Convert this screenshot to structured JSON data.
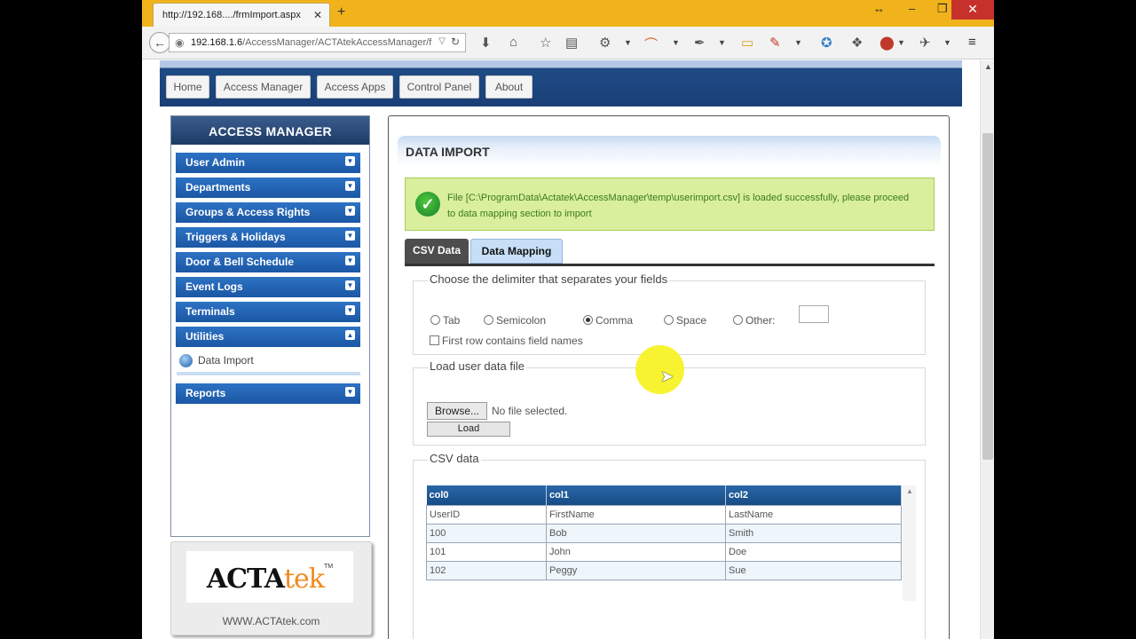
{
  "browser": {
    "tab_title": "http://192.168..../frmImport.aspx",
    "url_host": "192.168.1.6",
    "url_path": "/AccessManager/ACTAtekAccessManager/f"
  },
  "topmenu": [
    {
      "label": "Home"
    },
    {
      "label": "Access Manager"
    },
    {
      "label": "Access Apps"
    },
    {
      "label": "Control Panel"
    },
    {
      "label": "About"
    }
  ],
  "sidebar": {
    "title": "ACCESS MANAGER",
    "items": [
      {
        "label": "User Admin"
      },
      {
        "label": "Departments"
      },
      {
        "label": "Groups & Access Rights"
      },
      {
        "label": "Triggers & Holidays"
      },
      {
        "label": "Door & Bell Schedule"
      },
      {
        "label": "Event Logs"
      },
      {
        "label": "Terminals"
      },
      {
        "label": "Utilities"
      }
    ],
    "subitem": "Data Import",
    "reports": "Reports"
  },
  "logo": {
    "acta": "ACTA",
    "tek": "tek",
    "tm": "TM",
    "url": "WWW.ACTAtek.com"
  },
  "main": {
    "title": "DATA IMPORT",
    "success_message": "File [C:\\ProgramData\\Actatek\\AccessManager\\temp\\userimport.csv] is loaded successfully, please proceed to data mapping section to import",
    "tabs": [
      {
        "label": "CSV Data"
      },
      {
        "label": "Data Mapping"
      }
    ],
    "delimiter": {
      "legend": "Choose the delimiter that separates your fields",
      "options": [
        {
          "label": "Tab"
        },
        {
          "label": "Semicolon"
        },
        {
          "label": "Comma"
        },
        {
          "label": "Space"
        },
        {
          "label": "Other:"
        }
      ],
      "selected": "Comma",
      "first_row_label": "First row contains field names"
    },
    "load_file": {
      "legend": "Load user data file",
      "browse_label": "Browse...",
      "no_file_text": "No file selected.",
      "load_label": "Load"
    },
    "csv": {
      "legend": "CSV data",
      "headers": [
        "col0",
        "col1",
        "col2"
      ],
      "rows": [
        [
          "UserID",
          "FirstName",
          "LastName"
        ],
        [
          "100",
          "Bob",
          "Smith"
        ],
        [
          "101",
          "John",
          "Doe"
        ],
        [
          "102",
          "Peggy",
          "Sue"
        ]
      ]
    }
  }
}
